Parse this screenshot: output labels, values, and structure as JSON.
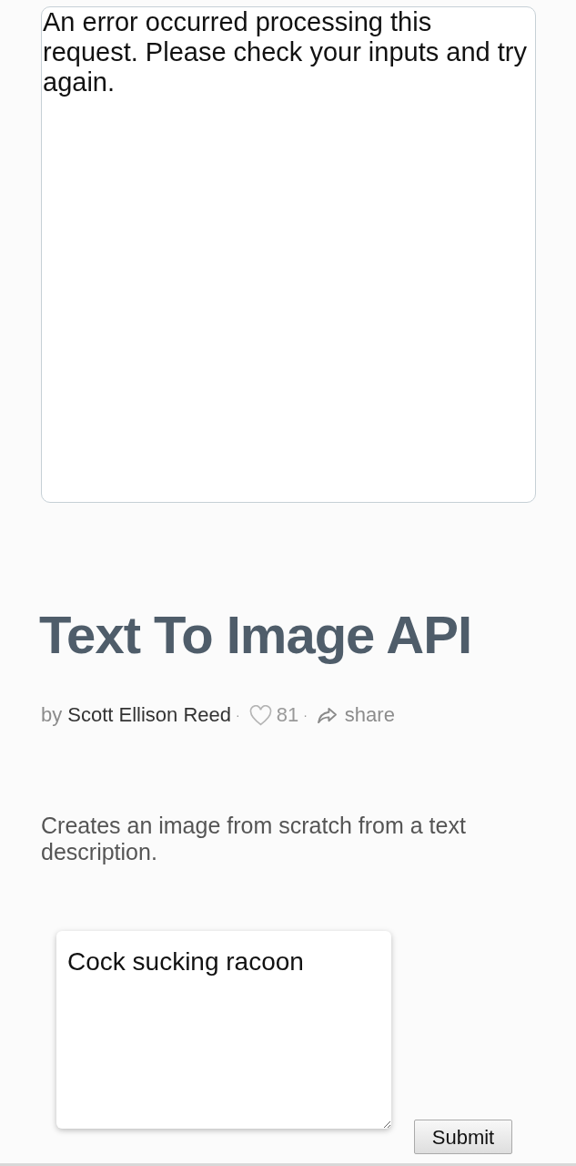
{
  "output": {
    "text": "An error occurred processing this request. Please check your inputs and try again."
  },
  "title": "Text To Image API",
  "byline": [
    {
      "kind": "text",
      "text": "by"
    },
    {
      "kind": "author",
      "text": "Scott Ellison Reed"
    },
    {
      "kind": "separator",
      "text": "·"
    },
    {
      "kind": "likes",
      "text": "81"
    },
    {
      "kind": "separator",
      "text": "·"
    },
    {
      "kind": "share",
      "text": "share"
    }
  ],
  "description": "Creates an image from scratch from a text description.",
  "prompt": {
    "value": "Cock sucking racoon"
  },
  "submit_button": "Submit"
}
